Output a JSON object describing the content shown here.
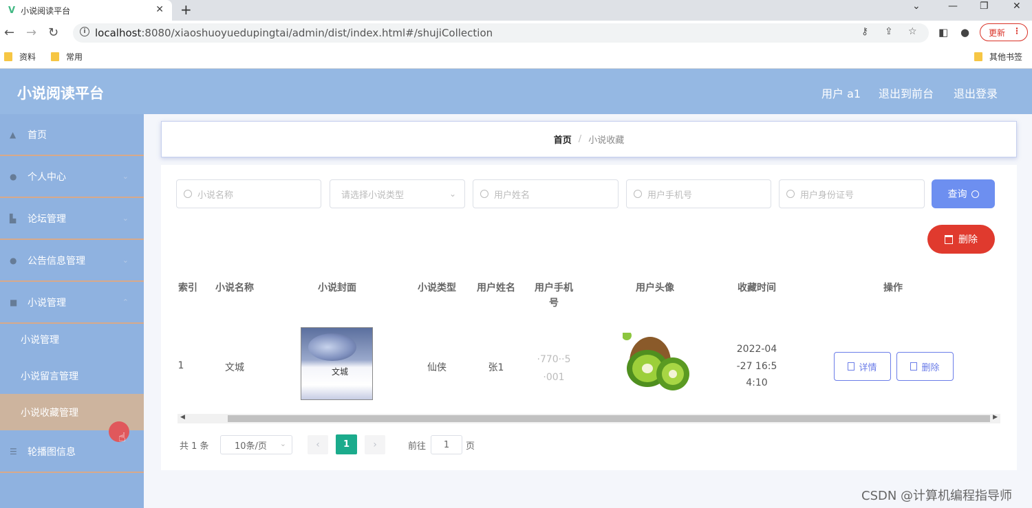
{
  "browser": {
    "tab_title": "小说阅读平台",
    "url_host": "localhost",
    "url_rest": ":8080/xiaoshuoyuedupingtai/admin/dist/index.html#/shujiCollection",
    "update_label": "更新",
    "bookmarks": [
      "资料",
      "常用"
    ],
    "other_bookmarks": "其他书签"
  },
  "header": {
    "title": "小说阅读平台",
    "user": "用户 a1",
    "to_front": "退出到前台",
    "logout": "退出登录"
  },
  "sidebar": {
    "items": [
      {
        "label": "首页"
      },
      {
        "label": "个人中心"
      },
      {
        "label": "论坛管理"
      },
      {
        "label": "公告信息管理"
      },
      {
        "label": "小说管理"
      }
    ],
    "submenu": [
      {
        "label": "小说管理"
      },
      {
        "label": "小说留言管理"
      },
      {
        "label": "小说收藏管理"
      }
    ],
    "last_item": {
      "label": "轮播图信息"
    }
  },
  "breadcrumb": {
    "home": "首页",
    "separator": "/",
    "current": "小说收藏"
  },
  "search": {
    "novel_name_placeholder": "小说名称",
    "novel_type_placeholder": "请选择小说类型",
    "user_name_placeholder": "用户姓名",
    "user_phone_placeholder": "用户手机号",
    "user_id_placeholder": "用户身份证号",
    "query_label": "查询",
    "delete_label": "删除"
  },
  "table": {
    "headers": {
      "index": "索引",
      "novel_name": "小说名称",
      "cover": "小说封面",
      "novel_type": "小说类型",
      "user_name": "用户姓名",
      "user_phone_1": "用户手机",
      "user_phone_2": "号",
      "avatar": "用户头像",
      "collect_time": "收藏时间",
      "actions": "操作"
    },
    "rows": [
      {
        "index": "1",
        "novel_name": "文城",
        "cover_title": "文城",
        "novel_type": "仙侠",
        "user_name": "张1",
        "phone_1": "·770··5",
        "phone_2": "·001",
        "time_1": "2022-04",
        "time_2": "-27 16:5",
        "time_3": "4:10",
        "detail_label": "详情",
        "delete_label": "删除"
      }
    ]
  },
  "pagination": {
    "total": "共 1 条",
    "page_size": "10条/页",
    "current_page": "1",
    "goto_prefix": "前往",
    "goto_value": "1",
    "goto_suffix": "页"
  },
  "watermark": "CSDN @计算机编程指导师"
}
